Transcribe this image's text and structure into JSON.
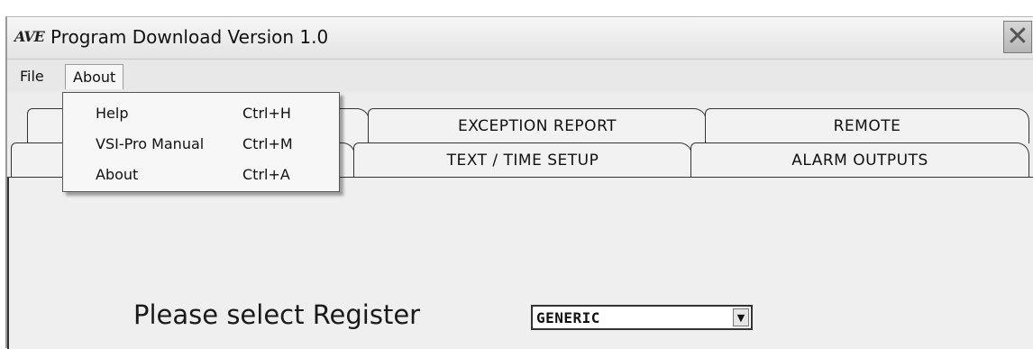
{
  "window": {
    "logo": "AVE",
    "title": "Program Download Version 1.0"
  },
  "menubar": {
    "items": [
      "File",
      "About"
    ]
  },
  "about_menu": {
    "items": [
      {
        "label": "Help",
        "shortcut": "Ctrl+H"
      },
      {
        "label": "VSI-Pro Manual",
        "shortcut": "Ctrl+M"
      },
      {
        "label": "About",
        "shortcut": "Ctrl+A"
      }
    ]
  },
  "tabs": {
    "row1": [
      "",
      "EXCEPTION REPORT",
      "REMOTE"
    ],
    "row2": [
      "",
      "TEXT / TIME SETUP",
      "ALARM OUTPUTS"
    ]
  },
  "main": {
    "prompt": "Please select Register",
    "register_select": {
      "value": "GENERIC"
    }
  },
  "icons": {
    "close": "close-icon",
    "dropdown_arrow": "chevron-down-icon"
  }
}
